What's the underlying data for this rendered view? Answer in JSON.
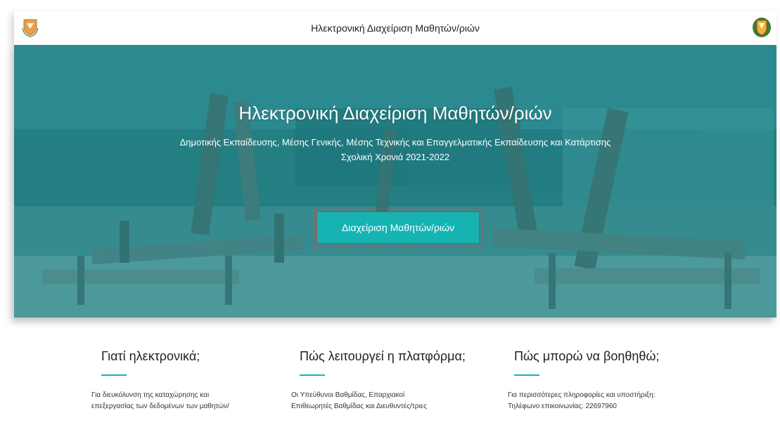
{
  "header": {
    "title": "Ηλεκτρονική Διαχείριση Μαθητών/ριών",
    "left_logo": "cyprus-coat-of-arms-icon",
    "right_logo": "ministry-emblem-icon"
  },
  "hero": {
    "title": "Ηλεκτρονική Διαχείριση Μαθητών/ριών",
    "subtitle_line1": "Δημοτικής Εκπαίδευσης, Μέσης Γενικής, Μέσης Τεχνικής και Επαγγελματικής Εκπαίδευσης και Κατάρτισης",
    "subtitle_line2": "Σχολική Χρονιά 2021-2022",
    "button_label": "Διαχείριση Μαθητών/ριών"
  },
  "info": {
    "col1": {
      "heading": "Γιατί ηλεκτρονικά;",
      "line1": "Για διευκόλυνση της καταχώρησης και",
      "line2": "επεξεργασίας των δεδομένων των μαθητών/"
    },
    "col2": {
      "heading": "Πώς λειτουργεί η πλατφόρμα;",
      "line1": "Οι Υπεύθυνοι Βαθμίδας, Επαρχιακοί",
      "line2": "Επιθεωρητές Βαθμίδας και Διευθυντές/τριες"
    },
    "col3": {
      "heading": "Πώς μπορώ να βοηθηθώ;",
      "line1": "Για περισσότερες πληροφορίες και υποστήριξη:",
      "line2": "Τηλέφωνο επικοινωνίας: 22697960"
    }
  },
  "colors": {
    "accent": "#16b3b3",
    "rule": "#17b3bb",
    "hero_tint": "#2f7c80"
  }
}
